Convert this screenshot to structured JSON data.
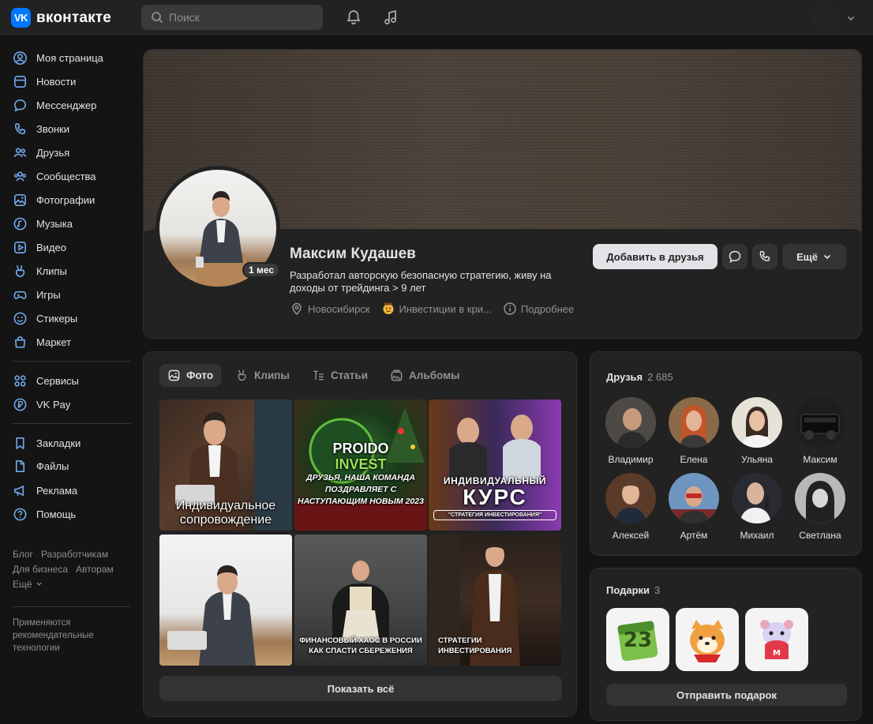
{
  "header": {
    "logo_mark": "VK",
    "logo_text": "вконтакте",
    "search_placeholder": "Поиск",
    "icons": [
      "bell-icon",
      "music-note-icon",
      "chevron-down-icon"
    ]
  },
  "sidebar": {
    "items": [
      {
        "label": "Моя страница",
        "icon": "user-circle-icon"
      },
      {
        "label": "Новости",
        "icon": "news-icon"
      },
      {
        "label": "Мессенджер",
        "icon": "chat-icon"
      },
      {
        "label": "Звонки",
        "icon": "phone-icon"
      },
      {
        "label": "Друзья",
        "icon": "friends-icon"
      },
      {
        "label": "Сообщества",
        "icon": "communities-icon"
      },
      {
        "label": "Фотографии",
        "icon": "photo-icon"
      },
      {
        "label": "Музыка",
        "icon": "music-icon"
      },
      {
        "label": "Видео",
        "icon": "video-icon"
      },
      {
        "label": "Клипы",
        "icon": "clips-icon"
      },
      {
        "label": "Игры",
        "icon": "gamepad-icon"
      },
      {
        "label": "Стикеры",
        "icon": "smile-icon"
      },
      {
        "label": "Маркет",
        "icon": "bag-icon"
      }
    ],
    "items2": [
      {
        "label": "Сервисы",
        "icon": "services-icon"
      },
      {
        "label": "VK Pay",
        "icon": "pay-icon"
      }
    ],
    "items3": [
      {
        "label": "Закладки",
        "icon": "bookmark-icon"
      },
      {
        "label": "Файлы",
        "icon": "file-icon"
      },
      {
        "label": "Реклама",
        "icon": "megaphone-icon"
      },
      {
        "label": "Помощь",
        "icon": "help-icon"
      }
    ],
    "footer": {
      "blog": "Блог",
      "developers": "Разработчикам",
      "business": "Для бизнеса",
      "authors": "Авторам",
      "more": "Ещё",
      "note": "Применяются рекомендательные технологии"
    }
  },
  "profile": {
    "name": "Максим Кудашев",
    "status": "Разработал авторскую безопасную стратегию, живу на доходы от трейдинга > 9 лет",
    "avatar_badge": "1 мес",
    "city": "Новосибирск",
    "interest": "Инвестиции в кри...",
    "details": "Подробнее",
    "add_friend": "Добавить в друзья",
    "more": "Ещё",
    "cover_color": "#463c34"
  },
  "photos": {
    "tabs": [
      {
        "label": "Фото",
        "icon": "photo-icon",
        "active": true
      },
      {
        "label": "Клипы",
        "icon": "clips-icon",
        "active": false
      },
      {
        "label": "Статьи",
        "icon": "article-icon",
        "active": false
      },
      {
        "label": "Альбомы",
        "icon": "album-icon",
        "active": false
      }
    ],
    "captions": {
      "p1": "Индивидуальное сопровождение",
      "p2_logo_top": "PROIDO",
      "p2_logo_bottom": "INVEST",
      "p2_banner": "ДРУЗЬЯ, НАША КОМАНДА ПОЗДРАВЛЯЕТ С НАСТУПАЮЩИМ НОВЫМ 2023",
      "p3_top": "ИНДИВИДУАЛЬНЫЙ",
      "p3_big": "КУРС",
      "p3_sub": "\"СТРАТЕГИЯ ИНВЕСТИРОВАНИЯ\"",
      "p5": "ФИНАНСОВЫЙ ХАОС В РОССИИ КАК СПАСТИ СБЕРЕЖЕНИЯ",
      "p6": "СТРАТЕГИИ ИНВЕСТИРОВАНИЯ"
    },
    "show_all": "Показать всё"
  },
  "friends": {
    "title": "Друзья",
    "count": "2 685",
    "list": [
      {
        "name": "Владимир",
        "color": "#5a5a5a"
      },
      {
        "name": "Елена",
        "color": "#b56a45"
      },
      {
        "name": "Ульяна",
        "color": "#d9d2c6"
      },
      {
        "name": "Максим",
        "color": "#2c2c2c"
      },
      {
        "name": "Алексей",
        "color": "#6b4a35"
      },
      {
        "name": "Артём",
        "color": "#6a8fb5"
      },
      {
        "name": "Михаил",
        "color": "#3a3a44"
      },
      {
        "name": "Светлана",
        "color": "#8a8a8a"
      }
    ]
  },
  "gifts": {
    "title": "Подарки",
    "count": "3",
    "items": [
      {
        "name": "calendar-gift-icon",
        "label": "23"
      },
      {
        "name": "shiba-gift-icon",
        "label": ""
      },
      {
        "name": "hamster-gift-icon",
        "label": ""
      }
    ],
    "send": "Отправить подарок"
  }
}
